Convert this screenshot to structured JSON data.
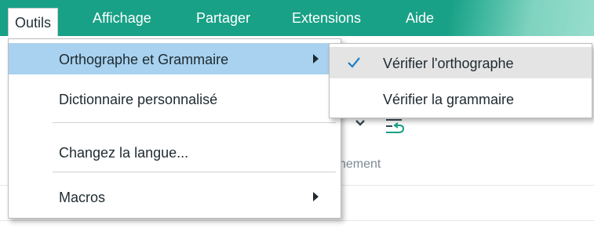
{
  "menubar": {
    "items": [
      {
        "label": "Outils",
        "active": true
      },
      {
        "label": "Affichage"
      },
      {
        "label": "Partager"
      },
      {
        "label": "Extensions"
      },
      {
        "label": "Aide"
      }
    ]
  },
  "background": {
    "partial_label": "nement"
  },
  "tools_menu": {
    "items": [
      {
        "label": "Orthographe et Grammaire",
        "submenu": true,
        "highlighted": true
      },
      {
        "label": "Dictionnaire personnalisé"
      },
      {
        "label": "Changez la langue..."
      },
      {
        "label": "Macros",
        "submenu": true
      }
    ]
  },
  "spelling_submenu": {
    "items": [
      {
        "label": "Vérifier l'orthographe",
        "checked": true
      },
      {
        "label": "Vérifier la grammaire"
      }
    ]
  },
  "colors": {
    "menubar": "#18a186",
    "highlight": "#a8d2ef",
    "check": "#1f7fc4"
  }
}
